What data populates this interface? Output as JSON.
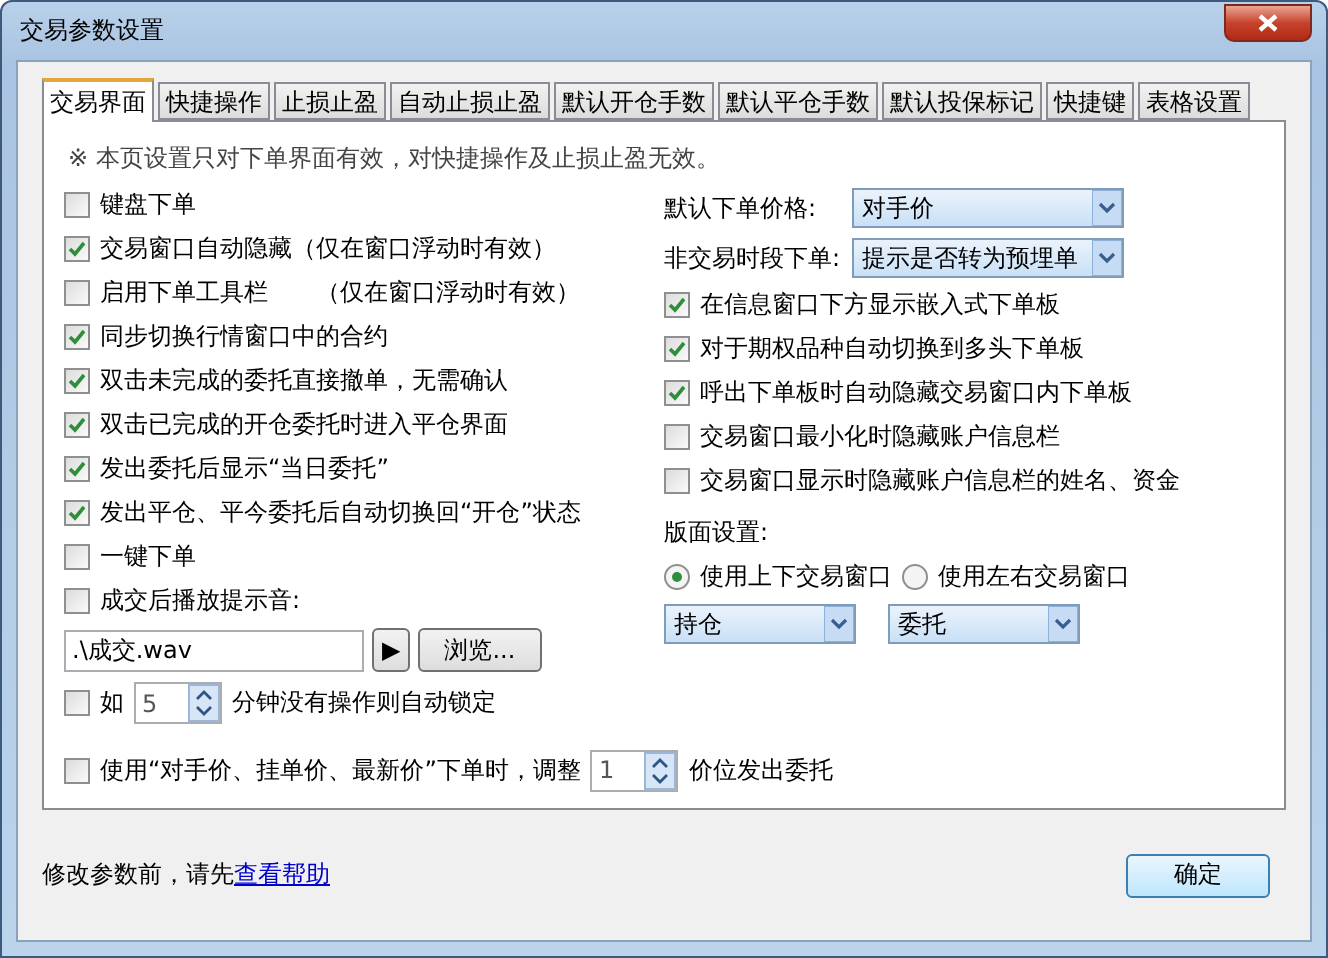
{
  "window": {
    "title": "交易参数设置"
  },
  "tabs": [
    {
      "label": "交易界面",
      "selected": true
    },
    {
      "label": "快捷操作",
      "selected": false
    },
    {
      "label": "止损止盈",
      "selected": false
    },
    {
      "label": "自动止损止盈",
      "selected": false
    },
    {
      "label": "默认开仓手数",
      "selected": false
    },
    {
      "label": "默认平仓手数",
      "selected": false
    },
    {
      "label": "默认投保标记",
      "selected": false
    },
    {
      "label": "快捷键",
      "selected": false
    },
    {
      "label": "表格设置",
      "selected": false
    }
  ],
  "notice": "※ 本页设置只对下单界面有效，对快捷操作及止损止盈无效。",
  "left_options": [
    {
      "label": "键盘下单",
      "checked": false
    },
    {
      "label": "交易窗口自动隐藏（仅在窗口浮动时有效）",
      "checked": true
    },
    {
      "label": "启用下单工具栏　　（仅在窗口浮动时有效）",
      "checked": false
    },
    {
      "label": "同步切换行情窗口中的合约",
      "checked": true
    },
    {
      "label": "双击未完成的委托直接撤单，无需确认",
      "checked": true
    },
    {
      "label": "双击已完成的开仓委托时进入平仓界面",
      "checked": true
    },
    {
      "label": "发出委托后显示“当日委托”",
      "checked": true
    },
    {
      "label": "发出平仓、平今委托后自动切换回“开仓”状态",
      "checked": true
    },
    {
      "label": "一键下单",
      "checked": false
    },
    {
      "label": "成交后播放提示音:",
      "checked": false
    }
  ],
  "sound_file": {
    "value": ".\\成交.wav",
    "play": "▶",
    "browse": "浏览..."
  },
  "auto_lock": {
    "checked": false,
    "prefix": "如",
    "value": "5",
    "suffix": "分钟没有操作则自动锁定"
  },
  "right_selects": [
    {
      "label": "默认下单价格:",
      "value": "对手价"
    },
    {
      "label": "非交易时段下单:",
      "value": "提示是否转为预埋单"
    }
  ],
  "right_options": [
    {
      "label": "在信息窗口下方显示嵌入式下单板",
      "checked": true
    },
    {
      "label": "对于期权品种自动切换到多头下单板",
      "checked": true
    },
    {
      "label": "呼出下单板时自动隐藏交易窗口内下单板",
      "checked": true
    },
    {
      "label": "交易窗口最小化时隐藏账户信息栏",
      "checked": false
    },
    {
      "label": "交易窗口显示时隐藏账户信息栏的姓名、资金",
      "checked": false
    }
  ],
  "layout": {
    "label": "版面设置:",
    "radios": [
      {
        "label": "使用上下交易窗口",
        "selected": true
      },
      {
        "label": "使用左右交易窗口",
        "selected": false
      }
    ],
    "dropdowns": [
      {
        "value": "持仓"
      },
      {
        "value": "委托"
      }
    ]
  },
  "price_adjust": {
    "checked": false,
    "prefix": "使用“对手价、挂单价、最新价”下单时，调整",
    "value": "1",
    "suffix": "价位发出委托"
  },
  "footer": {
    "text": "修改参数前，请先",
    "link": "查看帮助"
  },
  "ok_button": "确定"
}
